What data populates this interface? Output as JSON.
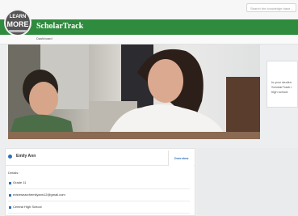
{
  "search": {
    "placeholder": "Search the knowledge base..."
  },
  "logo": {
    "line1": "LEARN",
    "line2": "MORE"
  },
  "brand": {
    "name": "ScholarTrack",
    "color": "#2f8c3e"
  },
  "breadcrumb": {
    "label": "Dashboard"
  },
  "hero": {
    "callout_text": "Is your studen\nScholarTrack i\nhigh school."
  },
  "student": {
    "name": "Emily Ann",
    "overview_tab": "Overview",
    "section_label": "Details:",
    "grade": "Grade 11",
    "email": "edsresearchemilyann12@gmail.com",
    "school": "Central High School"
  },
  "colors": {
    "accent": "#2f6fb5"
  }
}
